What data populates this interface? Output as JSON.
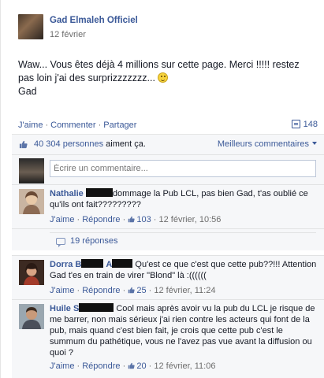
{
  "post": {
    "page_name": "Gad Elmaleh Officiel",
    "date": "12 février",
    "text_line1": "Waw... Vous êtes déjà 4 millions sur cette page. Merci !!!!! restez pas loin j'ai des surprizzzzzzz...",
    "text_line2": "Gad"
  },
  "actions": {
    "like": "J'aime",
    "comment": "Commenter",
    "share": "Partager",
    "share_count": "148"
  },
  "likes": {
    "count_link": "40 304 personnes",
    "suffix": " aiment ça.",
    "best_comments": "Meilleurs commentaires"
  },
  "comment_box": {
    "placeholder": "Écrire un commentaire..."
  },
  "comments": [
    {
      "author": "Nathalie",
      "text": "dommage la Pub LCL, pas bien Gad, t'as oublié ce qu'ils ont fait?????????",
      "like": "J'aime",
      "reply": "Répondre",
      "likes": "103",
      "time": "12 février, 10:56"
    },
    {
      "author": "Dorra B",
      "author2": "A",
      "text": "Qu'est ce que c'est que cette pub??!!! Attention Gad t'es en train de virer \"Blond\" là :((((((",
      "like": "J'aime",
      "reply": "Répondre",
      "likes": "25",
      "time": "12 février, 11:24"
    },
    {
      "author": "Huile S",
      "text": "Cool mais après avoir vu la pub du LCL je risque de me barrer, non mais sérieux j'ai rien contre les acteurs qui font de la pub, mais quand c'est bien fait, je crois que cette pub c'est le summum du pathétique, vous ne l'avez pas vue avant la diffusion ou quoi ?",
      "like": "J'aime",
      "reply": "Répondre",
      "likes": "20",
      "time": "12 février, 11:06"
    }
  ],
  "replies": {
    "label": "19 réponses"
  },
  "colors": {
    "link": "#3b5998",
    "meta": "#6d6d6d",
    "panel": "#f6f7f9"
  }
}
